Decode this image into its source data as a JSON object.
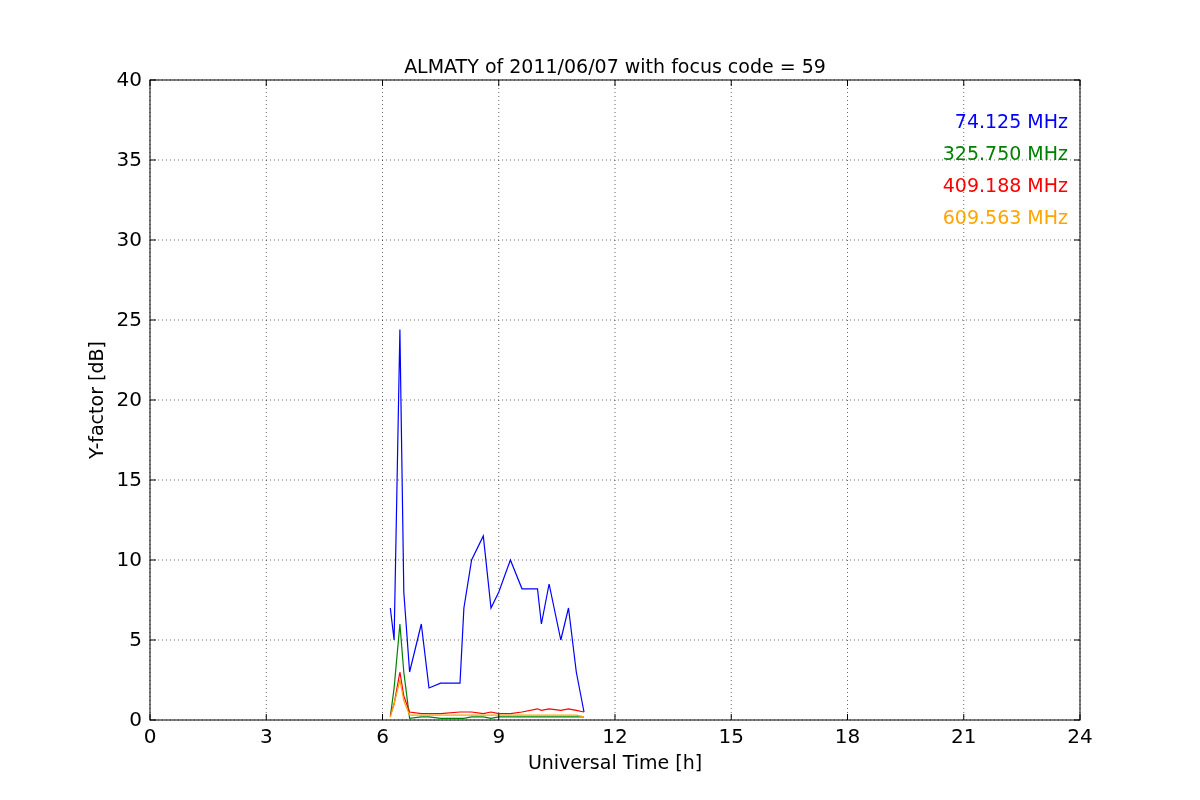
{
  "chart_data": {
    "type": "line",
    "title": "ALMATY of 2011/06/07 with focus code = 59",
    "xlabel": "Universal Time [h]",
    "ylabel": "Y-factor [dB]",
    "x": [
      6.2,
      6.3,
      6.45,
      6.55,
      6.7,
      7.0,
      7.2,
      7.5,
      8.0,
      8.1,
      8.3,
      8.6,
      8.8,
      9.0,
      9.3,
      9.6,
      10.0,
      10.1,
      10.3,
      10.6,
      10.8,
      11.0,
      11.2
    ],
    "series": [
      {
        "name": "74.125 MHz",
        "color": "#0000ff",
        "values": [
          7,
          5,
          24.4,
          8,
          3,
          6,
          2,
          2.3,
          2.3,
          7,
          10,
          11.5,
          7,
          8,
          10,
          8.2,
          8.2,
          6,
          8.5,
          5,
          7,
          3,
          0.5
        ]
      },
      {
        "name": "325.750 MHz",
        "color": "#008000",
        "values": [
          0.2,
          2,
          6,
          3,
          0.1,
          0.2,
          0.2,
          0.1,
          0.1,
          0.1,
          0.2,
          0.2,
          0.1,
          0.2,
          0.2,
          0.2,
          0.2,
          0.2,
          0.2,
          0.2,
          0.2,
          0.2,
          0.2
        ]
      },
      {
        "name": "409.188 MHz",
        "color": "#ff0000",
        "values": [
          0.3,
          1,
          3,
          1.5,
          0.5,
          0.4,
          0.4,
          0.4,
          0.5,
          0.5,
          0.5,
          0.4,
          0.5,
          0.4,
          0.4,
          0.5,
          0.7,
          0.6,
          0.7,
          0.6,
          0.7,
          0.6,
          0.5
        ]
      },
      {
        "name": "609.563 MHz",
        "color": "#ffa500",
        "values": [
          0.2,
          1,
          2.5,
          1.2,
          0.3,
          0.3,
          0.3,
          0.3,
          0.3,
          0.3,
          0.3,
          0.3,
          0.3,
          0.3,
          0.3,
          0.3,
          0.3,
          0.3,
          0.3,
          0.3,
          0.3,
          0.3,
          0.2
        ]
      }
    ],
    "grid": true,
    "xlim": [
      0,
      24
    ],
    "ylim": [
      0,
      40
    ],
    "xticks": [
      0,
      3,
      6,
      9,
      12,
      15,
      18,
      21,
      24
    ],
    "yticks": [
      0,
      5,
      10,
      15,
      20,
      25,
      30,
      35,
      40
    ]
  }
}
